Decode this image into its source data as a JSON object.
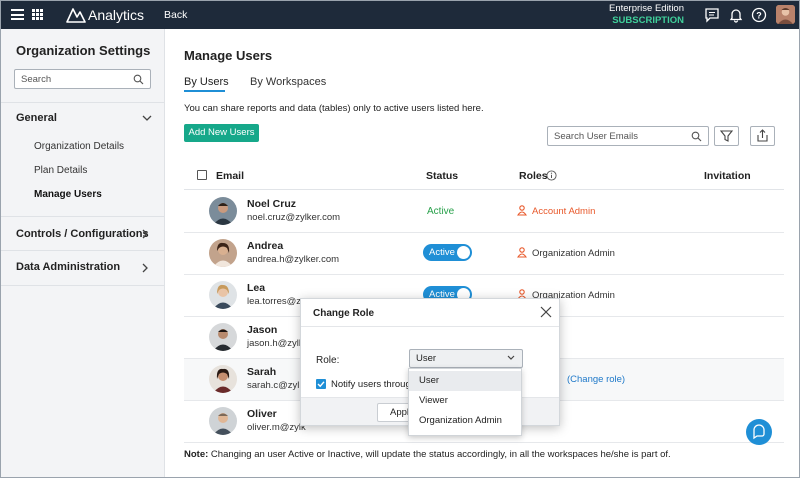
{
  "topbar": {
    "app_title": "Analytics",
    "back_label": "Back",
    "edition": "Enterprise Edition",
    "subscription": "SUBSCRIPTION",
    "icons": [
      "menu-icon",
      "apps-grid-icon",
      "analytics-logo-icon",
      "feedback-icon",
      "bell-icon",
      "help-icon",
      "avatar"
    ]
  },
  "sidebar": {
    "title": "Organization Settings",
    "search_placeholder": "Search",
    "sections": [
      {
        "label": "General",
        "expanded": true,
        "items": [
          "Organization Details",
          "Plan Details",
          "Manage Users"
        ]
      },
      {
        "label": "Controls / Configurations",
        "expanded": false
      },
      {
        "label": "Data Administration",
        "expanded": false
      }
    ],
    "active_item": "Manage Users"
  },
  "main": {
    "title": "Manage Users",
    "tabs": [
      {
        "label": "By Users",
        "active": true
      },
      {
        "label": "By Workspaces",
        "active": false
      }
    ],
    "info_text": "You can share reports and data (tables) only to active users listed here.",
    "add_button": "Add New Users",
    "email_search_placeholder": "Search User Emails",
    "columns": {
      "email": "Email",
      "status": "Status",
      "roles": "Roles",
      "invitation": "Invitation"
    },
    "users": [
      {
        "name": "Noel Cruz",
        "email": "noel.cruz@zylker.com",
        "status": "Active",
        "role": "Account Admin"
      },
      {
        "name": "Andrea",
        "email": "andrea.h@zylker.com",
        "status": "Active",
        "role": "Organization Admin"
      },
      {
        "name": "Lea",
        "email": "lea.torres@z",
        "status": "Active",
        "role": "Organization Admin"
      },
      {
        "name": "Jason",
        "email": "jason.h@zylke",
        "status": "",
        "role": ""
      },
      {
        "name": "Sarah",
        "email": "sarah.c@zylk",
        "status": "",
        "role": "",
        "action": "(Change role)"
      },
      {
        "name": "Oliver",
        "email": "oliver.m@zylk",
        "status": "",
        "role": ""
      }
    ],
    "note_label": "Note:",
    "note_text": "Changing an user Active or Inactive, will update the status accordingly, in all the workspaces he/she is part of."
  },
  "dialog": {
    "title": "Change Role",
    "role_label": "Role:",
    "role_value": "User",
    "notify_label": "Notify users through",
    "notify_checked": true,
    "apply_label": "Apply",
    "options": [
      "User",
      "Viewer",
      "Organization Admin"
    ],
    "highlighted_option": "User"
  },
  "colors": {
    "topbar": "#1e2a3a",
    "accent": "#1f8fd6",
    "add_button": "#16a88a",
    "active_status": "#27a04a",
    "account_admin": "#e8582a",
    "subscription": "#3fcf9a"
  }
}
